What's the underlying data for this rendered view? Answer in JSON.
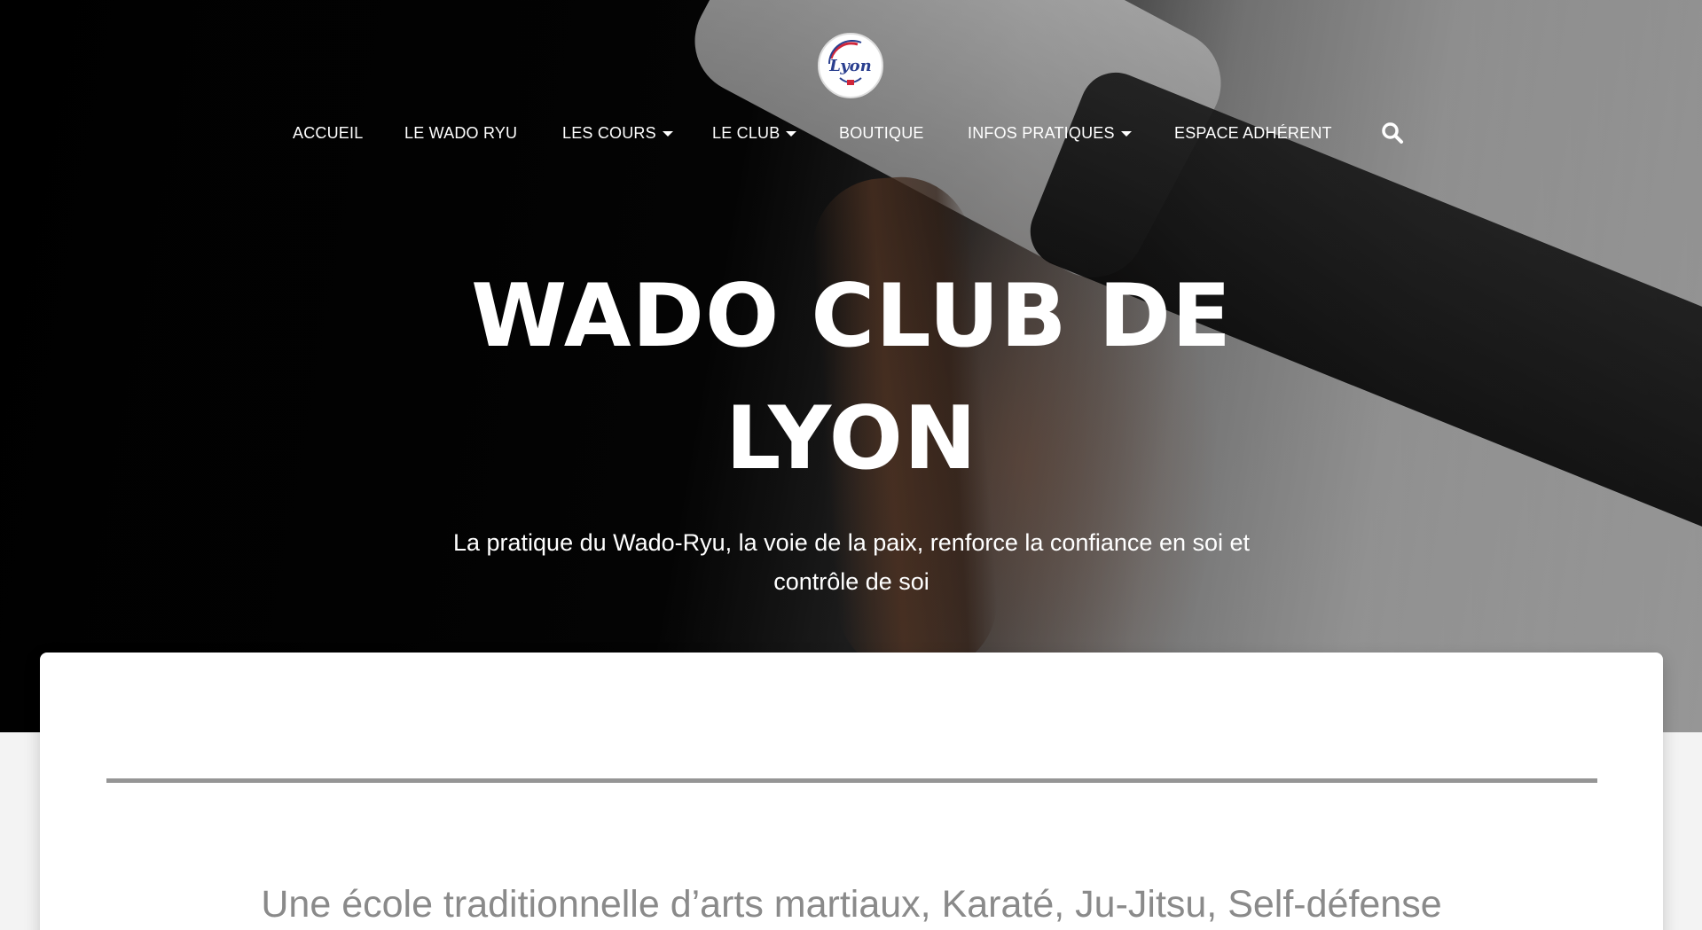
{
  "site": {
    "logo_text": "Lyon"
  },
  "nav": {
    "items": [
      {
        "label": "ACCUEIL",
        "has_dropdown": false
      },
      {
        "label": "LE WADO RYU",
        "has_dropdown": false
      },
      {
        "label": "LES COURS",
        "has_dropdown": true
      },
      {
        "label": "LE CLUB",
        "has_dropdown": true
      },
      {
        "label": "BOUTIQUE",
        "has_dropdown": false
      },
      {
        "label": "INFOS PRATIQUES",
        "has_dropdown": true
      },
      {
        "label": "ESPACE ADHÉRENT",
        "has_dropdown": false
      }
    ],
    "search_icon": "search-icon"
  },
  "hero": {
    "title_line1": "WADO CLUB DE",
    "title_line2": "LYON",
    "subtitle_line1": "La pratique du Wado-Ryu, la voie de la paix, renforce la confiance en soi et",
    "subtitle_line2": "contrôle de soi"
  },
  "content": {
    "heading": "Une école traditionnelle d’arts martiaux, Karaté, Ju-Jitsu, Self-défense"
  },
  "colors": {
    "nav_text": "#ffffff",
    "divider": "#959595",
    "heading_text": "#8a8a8a",
    "logo_red": "#d0263a",
    "logo_blue": "#2a3f8f"
  }
}
